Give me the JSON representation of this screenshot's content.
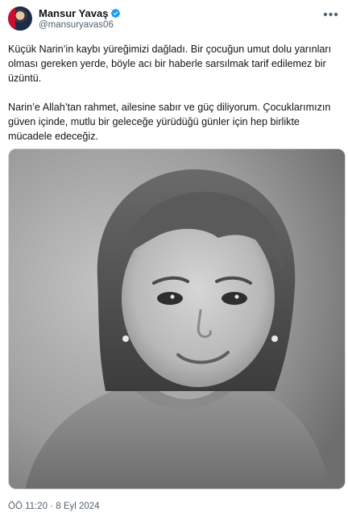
{
  "author": {
    "display_name": "Mansur Yavaş",
    "handle": "@mansuryavas06",
    "verified": true,
    "verified_color": "#1d9bf0"
  },
  "tweet": {
    "paragraph1": "Küçük Narin’in kaybı yüreğimizi dağladı. Bir çocuğun umut dolu yarınları olması gereken yerde, böyle acı bir haberle sarsılmak tarif edilemez bir üzüntü.",
    "paragraph2": "Narin’e Allah’tan rahmet, ailesine sabır ve güç diliyorum. Çocuklarımızın güven içinde, mutlu bir geleceğe yürüdüğü günler için hep birlikte mücadele edeceğiz."
  },
  "media": {
    "type": "photo",
    "style": "black-and-white"
  },
  "meta": {
    "timestamp": "ÖÖ 11:20 · 8 Eyl 2024"
  },
  "icons": {
    "more": "more-horizontal-icon",
    "verified": "verified-badge-icon"
  }
}
